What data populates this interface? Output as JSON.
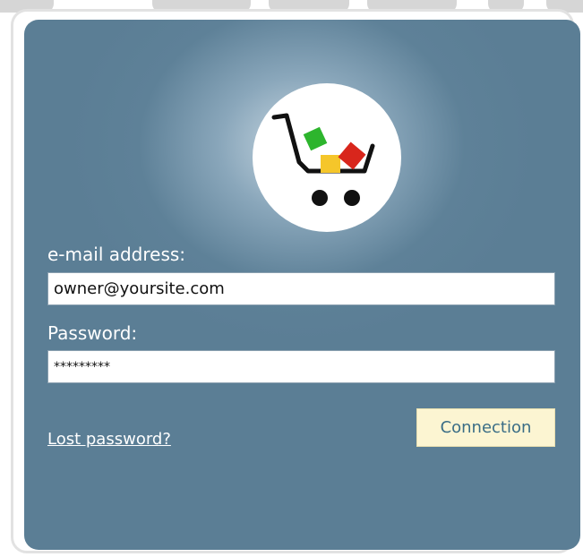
{
  "logo": {
    "icon": "shopping-cart-icon",
    "colors": {
      "green_box": "#2db52d",
      "red_box": "#d8261c",
      "yellow_box": "#f5c62a",
      "cart": "#111111"
    }
  },
  "form": {
    "email_label": "e-mail address:",
    "email_value": "owner@yoursite.com",
    "password_label": "Password:",
    "password_value": "*********",
    "lost_password_link": "Lost password?",
    "connect_button": "Connection"
  },
  "colors": {
    "panel": "#5b7e95",
    "button_bg": "#fcf5d2",
    "button_text": "#3a6d86"
  }
}
